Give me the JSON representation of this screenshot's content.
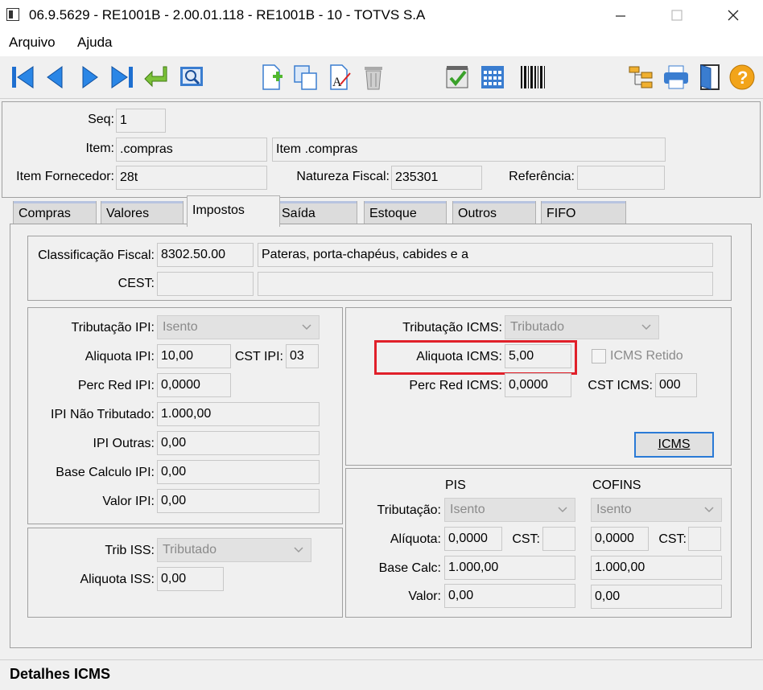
{
  "window": {
    "title": "06.9.5629 - RE1001B - 2.00.01.118 - RE1001B - 10 - TOTVS S.A",
    "minimize_icon": "minimize-icon",
    "maximize_icon": "maximize-icon",
    "close_icon": "close-icon"
  },
  "menu": {
    "file": "Arquivo",
    "help": "Ajuda"
  },
  "toolbar": {
    "icons": [
      "first-record-icon",
      "previous-record-icon",
      "next-record-icon",
      "last-record-icon",
      "go-to-icon",
      "search-icon",
      "new-document-icon",
      "copy-icon",
      "edit-document-icon",
      "delete-icon",
      "checklist-icon",
      "calendar-icon",
      "barcode-icon",
      "hierarchy-icon",
      "print-icon",
      "exit-door-icon",
      "help-icon"
    ]
  },
  "header": {
    "seq_label": "Seq:",
    "seq_value": "1",
    "item_label": "Item:",
    "item_code": ".compras",
    "item_desc": "Item .compras",
    "item_fornecedor_label": "Item Fornecedor:",
    "item_fornecedor_value": "28t",
    "natureza_label": "Natureza Fiscal:",
    "natureza_value": "235301",
    "referencia_label": "Referência:",
    "referencia_value": ""
  },
  "tabs": [
    "Compras",
    "Valores",
    "Impostos",
    "Saída",
    "Estoque",
    "Outros",
    "FIFO"
  ],
  "classificacao": {
    "label": "Classificação Fiscal:",
    "code": "8302.50.00",
    "desc": "Pateras, porta-chapéus, cabides e a",
    "cest_label": "CEST:",
    "cest_code": "",
    "cest_desc": ""
  },
  "ipi": {
    "trib_label": "Tributação IPI:",
    "trib_value": "Isento",
    "aliquota_label": "Aliquota IPI:",
    "aliquota_value": "10,00",
    "cst_label": "CST IPI:",
    "cst_value": "03",
    "perc_red_label": "Perc Red IPI:",
    "perc_red_value": "0,0000",
    "nao_trib_label": "IPI Não Tributado:",
    "nao_trib_value": "1.000,00",
    "outras_label": "IPI Outras:",
    "outras_value": "0,00",
    "base_label": "Base Calculo IPI:",
    "base_value": "0,00",
    "valor_label": "Valor IPI:",
    "valor_value": "0,00"
  },
  "iss": {
    "trib_label": "Trib ISS:",
    "trib_value": "Tributado",
    "aliquota_label": "Aliquota ISS:",
    "aliquota_value": "0,00"
  },
  "icms": {
    "trib_label": "Tributação ICMS:",
    "trib_value": "Tributado",
    "aliquota_label": "Aliquota ICMS:",
    "aliquota_value": "5,00",
    "retido_label": "ICMS Retido",
    "perc_red_label": "Perc Red ICMS:",
    "perc_red_value": "0,0000",
    "cst_label": "CST ICMS:",
    "cst_value": "000",
    "button_label": "ICMS",
    "highlight_color": "#e0202a"
  },
  "pis_cofins": {
    "pis_title": "PIS",
    "cofins_title": "COFINS",
    "trib_label": "Tributação:",
    "aliquota_label": "Alíquota:",
    "cst_label": "CST:",
    "base_label": "Base Calc:",
    "valor_label": "Valor:",
    "pis_trib": "Isento",
    "pis_aliquota": "0,0000",
    "pis_cst": "",
    "pis_base": "1.000,00",
    "pis_valor": "0,00",
    "cofins_trib": "Isento",
    "cofins_aliquota": "0,0000",
    "cofins_cst": "",
    "cofins_base": "1.000,00",
    "cofins_valor": "0,00"
  },
  "status": {
    "text": "Detalhes ICMS"
  }
}
